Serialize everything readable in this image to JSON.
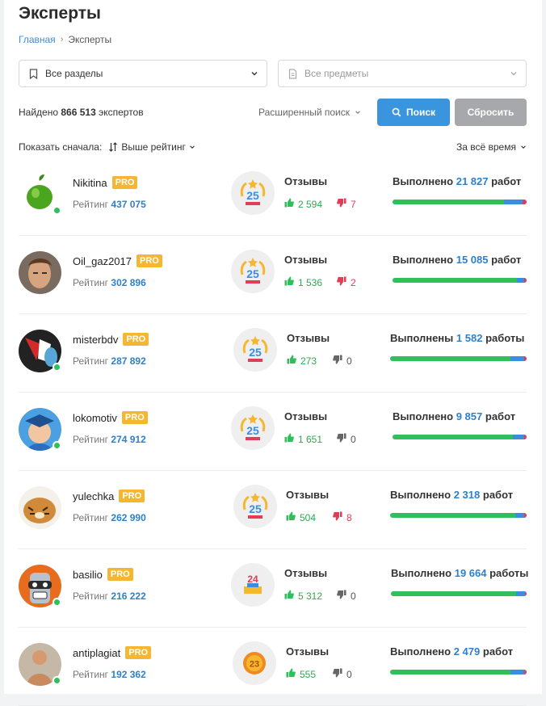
{
  "title": "Эксперты",
  "breadcrumb": {
    "home": "Главная",
    "sep": "›",
    "current": "Эксперты"
  },
  "filters": {
    "sections": "Все разделы",
    "subjects": "Все предметы"
  },
  "found": {
    "prefix": "Найдено",
    "count": "866 513",
    "suffix": "экспертов"
  },
  "advanced_search": "Расширенный поиск",
  "buttons": {
    "search": "Поиск",
    "reset": "Сбросить"
  },
  "sort": {
    "label": "Показать сначала:",
    "value": "Выше рейтинг"
  },
  "period": "За всё время",
  "colors": {
    "accent": "#3a95df",
    "pro": "#f5b731",
    "like": "#2fbf5b",
    "dislike": "#e23c56",
    "link": "#2f80c9"
  },
  "experts": [
    {
      "name": "Nikitina",
      "pro": "PRO",
      "rating_label": "Рейтинг",
      "rating": "437 075",
      "medal": "25",
      "reviews_label": "Отзывы",
      "likes": "2 594",
      "dislikes": "7",
      "done_label": "Выполнено",
      "done": "21 827",
      "done_suffix": "работ",
      "online": true,
      "bar": [
        0.83,
        0.14,
        0.03
      ]
    },
    {
      "name": "Oil_gaz2017",
      "pro": "PRO",
      "rating_label": "Рейтинг",
      "rating": "302 896",
      "medal": "25",
      "reviews_label": "Отзывы",
      "likes": "1 536",
      "dislikes": "2",
      "done_label": "Выполнено",
      "done": "15 085",
      "done_suffix": "работ",
      "online": false,
      "bar": [
        0.93,
        0.05,
        0.02
      ]
    },
    {
      "name": "misterbdv",
      "pro": "PRO",
      "rating_label": "Рейтинг",
      "rating": "287 892",
      "medal": "25",
      "reviews_label": "Отзывы",
      "likes": "273",
      "dislikes": "0",
      "done_label": "Выполнены",
      "done": "1 582",
      "done_suffix": "работы",
      "online": true,
      "bar": [
        0.88,
        0.1,
        0.02
      ]
    },
    {
      "name": "lokomotiv",
      "pro": "PRO",
      "rating_label": "Рейтинг",
      "rating": "274 912",
      "medal": "25",
      "reviews_label": "Отзывы",
      "likes": "1 651",
      "dislikes": "0",
      "done_label": "Выполнено",
      "done": "9 857",
      "done_suffix": "работ",
      "online": true,
      "bar": [
        0.9,
        0.08,
        0.02
      ]
    },
    {
      "name": "yulechka",
      "pro": "PRO",
      "rating_label": "Рейтинг",
      "rating": "262 990",
      "medal": "25",
      "reviews_label": "Отзывы",
      "likes": "504",
      "dislikes": "8",
      "done_label": "Выполнено",
      "done": "2 318",
      "done_suffix": "работ",
      "online": false,
      "bar": [
        0.92,
        0.06,
        0.02
      ]
    },
    {
      "name": "basilio",
      "pro": "PRO",
      "rating_label": "Рейтинг",
      "rating": "216 222",
      "medal": "24",
      "reviews_label": "Отзывы",
      "likes": "5 312",
      "dislikes": "0",
      "done_label": "Выполнено",
      "done": "19 664",
      "done_suffix": "работы",
      "online": true,
      "bar": [
        0.92,
        0.07,
        0.01
      ]
    },
    {
      "name": "antiplagiat",
      "pro": "PRO",
      "rating_label": "Рейтинг",
      "rating": "192 362",
      "medal": "23",
      "reviews_label": "Отзывы",
      "likes": "555",
      "dislikes": "0",
      "done_label": "Выполнено",
      "done": "2 479",
      "done_suffix": "работ",
      "online": true,
      "bar": [
        0.88,
        0.1,
        0.02
      ]
    }
  ]
}
